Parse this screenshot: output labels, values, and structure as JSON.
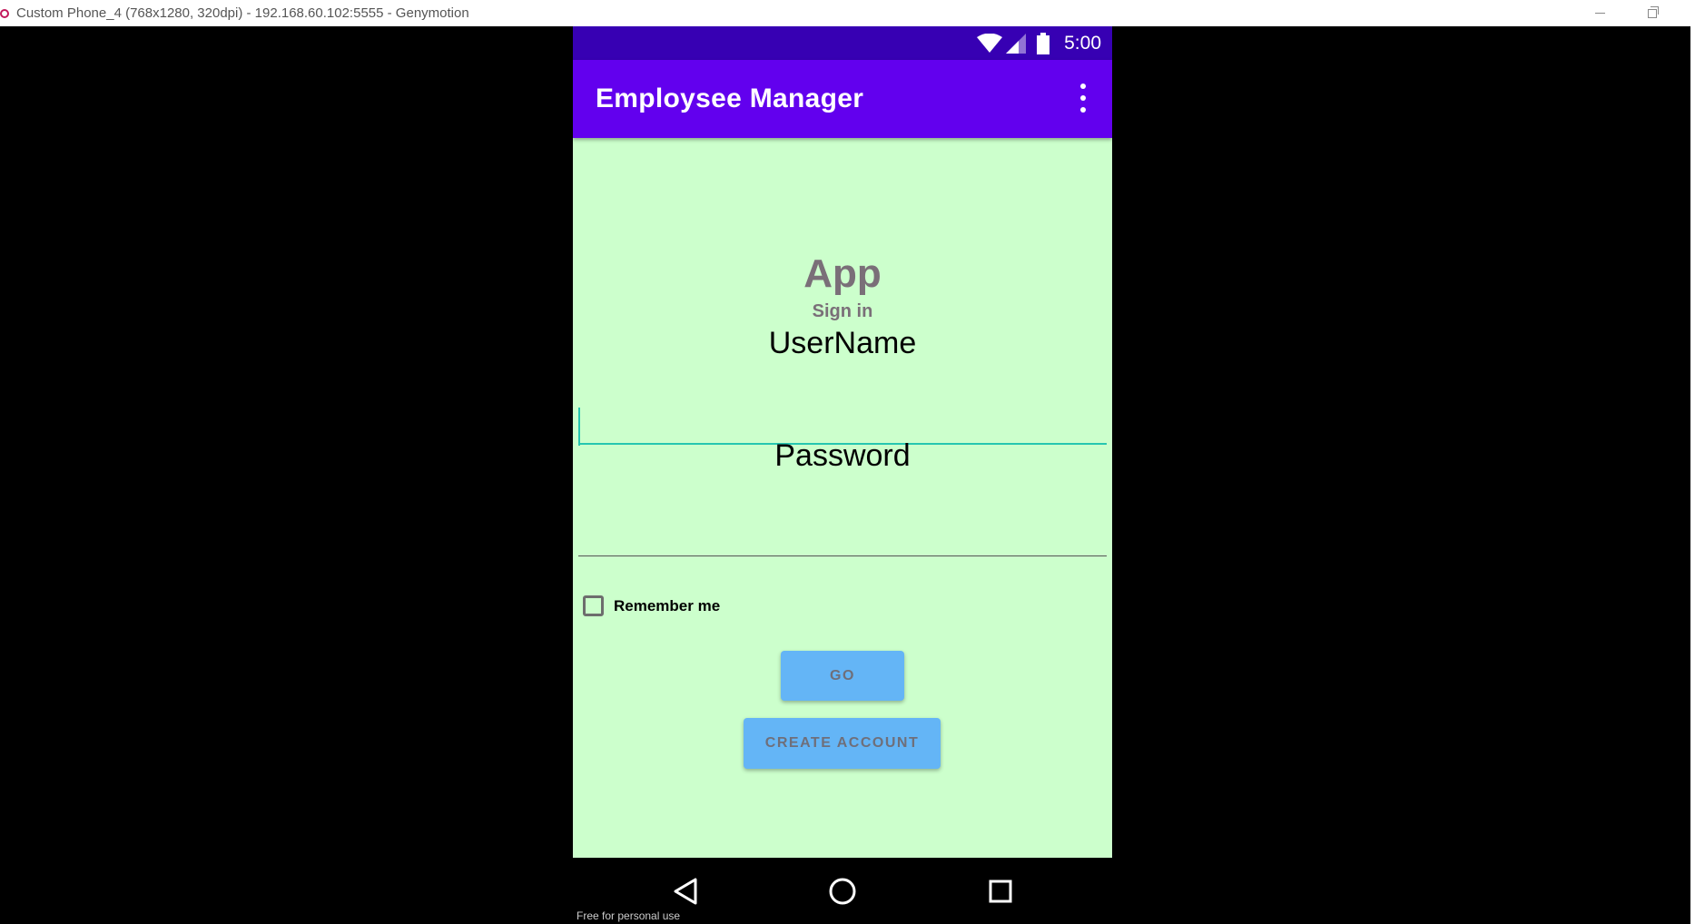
{
  "window": {
    "title": "Custom Phone_4 (768x1280, 320dpi) - 192.168.60.102:5555 - Genymotion"
  },
  "statusbar": {
    "time": "5:00",
    "icons": [
      "wifi-icon",
      "signal-icon",
      "battery-icon"
    ]
  },
  "appbar": {
    "title": "Employsee Manager",
    "menu_icon": "overflow-menu-icon"
  },
  "login": {
    "heading": "App",
    "subheading": "Sign in",
    "username_label": "UserName",
    "username_value": "",
    "password_label": "Password",
    "password_value": "",
    "remember_label": "Remember me",
    "remember_checked": false,
    "go_label": "GO",
    "create_account_label": "CREATE ACCOUNT"
  },
  "navbar": {
    "buttons": [
      "back-icon",
      "home-icon",
      "recents-icon"
    ]
  },
  "watermark": "Free for personal use",
  "colors": {
    "statusbar": "#3700b3",
    "appbar": "#6200ee",
    "content_bg": "#ccffcc",
    "accent": "#26c6b0",
    "button": "#64b5f6"
  }
}
